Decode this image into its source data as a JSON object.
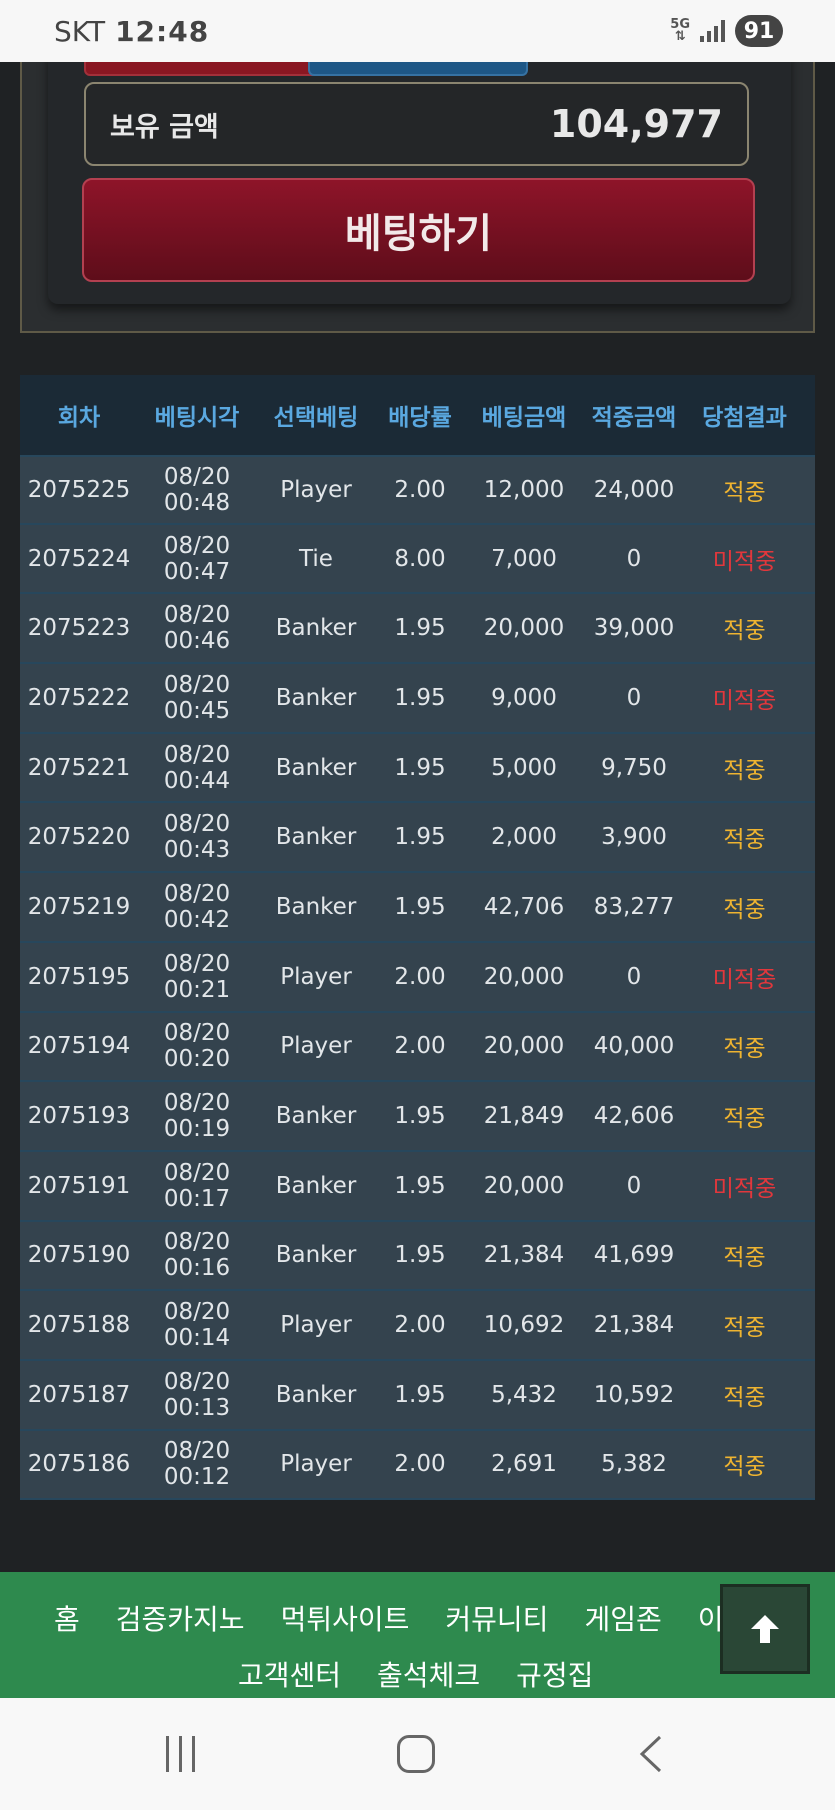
{
  "status_bar": {
    "carrier": "SKT",
    "time": "12:48",
    "network": "5G",
    "battery": "91"
  },
  "bet_panel": {
    "balance_label": "보유 금액",
    "balance_value": "104,977",
    "bet_button_label": "베팅하기"
  },
  "table": {
    "headers": [
      "회차",
      "베팅시각",
      "선택베팅",
      "배당률",
      "베팅금액",
      "적중금액",
      "당첨결과"
    ],
    "rows": [
      [
        "2075225",
        "08/20 00:48",
        "Player",
        "2.00",
        "12,000",
        "24,000",
        "적중"
      ],
      [
        "2075224",
        "08/20 00:47",
        "Tie",
        "8.00",
        "7,000",
        "0",
        "미적중"
      ],
      [
        "2075223",
        "08/20 00:46",
        "Banker",
        "1.95",
        "20,000",
        "39,000",
        "적중"
      ],
      [
        "2075222",
        "08/20 00:45",
        "Banker",
        "1.95",
        "9,000",
        "0",
        "미적중"
      ],
      [
        "2075221",
        "08/20 00:44",
        "Banker",
        "1.95",
        "5,000",
        "9,750",
        "적중"
      ],
      [
        "2075220",
        "08/20 00:43",
        "Banker",
        "1.95",
        "2,000",
        "3,900",
        "적중"
      ],
      [
        "2075219",
        "08/20 00:42",
        "Banker",
        "1.95",
        "42,706",
        "83,277",
        "적중"
      ],
      [
        "2075195",
        "08/20 00:21",
        "Player",
        "2.00",
        "20,000",
        "0",
        "미적중"
      ],
      [
        "2075194",
        "08/20 00:20",
        "Player",
        "2.00",
        "20,000",
        "40,000",
        "적중"
      ],
      [
        "2075193",
        "08/20 00:19",
        "Banker",
        "1.95",
        "21,849",
        "42,606",
        "적중"
      ],
      [
        "2075191",
        "08/20 00:17",
        "Banker",
        "1.95",
        "20,000",
        "0",
        "미적중"
      ],
      [
        "2075190",
        "08/20 00:16",
        "Banker",
        "1.95",
        "21,384",
        "41,699",
        "적중"
      ],
      [
        "2075188",
        "08/20 00:14",
        "Player",
        "2.00",
        "10,692",
        "21,384",
        "적중"
      ],
      [
        "2075187",
        "08/20 00:13",
        "Banker",
        "1.95",
        "5,432",
        "10,592",
        "적중"
      ],
      [
        "2075186",
        "08/20 00:12",
        "Player",
        "2.00",
        "2,691",
        "5,382",
        "적중"
      ]
    ],
    "result_colors": {
      "적중": "#efb430",
      "미적중": "#e2373c"
    }
  },
  "footer_nav": {
    "row1": [
      "홈",
      "검증카지노",
      "먹튀사이트",
      "커뮤니티",
      "게임존",
      "이벤트"
    ],
    "row2": [
      "고객센터",
      "출석체크",
      "규정집"
    ]
  },
  "icons": {
    "scroll_top": "arrow-up-icon",
    "nav_recent": "recent-apps-icon",
    "nav_home": "home-icon",
    "nav_back": "back-icon"
  }
}
